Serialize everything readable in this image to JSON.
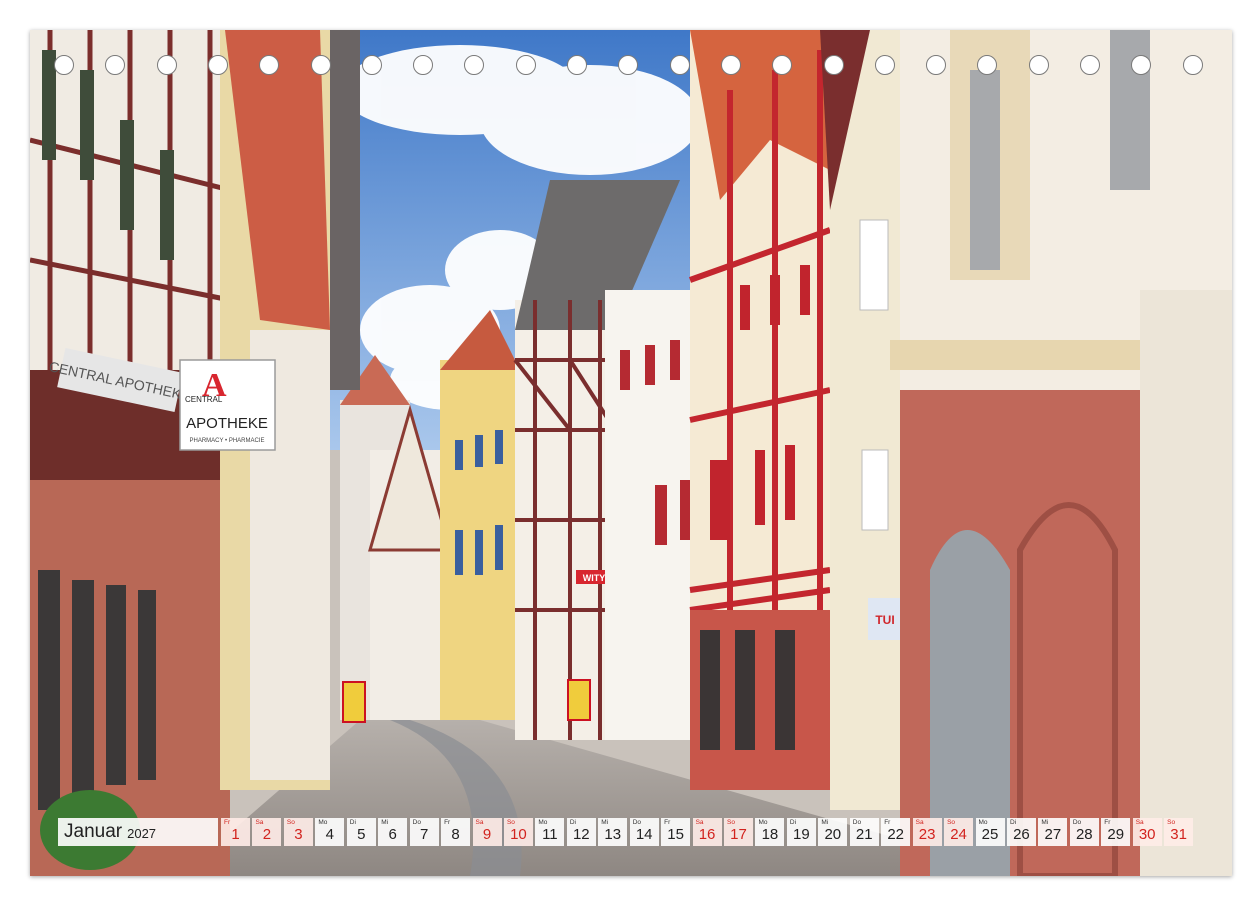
{
  "calendar": {
    "month": "Januar",
    "year": "2027",
    "days": [
      {
        "wd": "Fr",
        "num": "1",
        "weekend": true
      },
      {
        "wd": "Sa",
        "num": "2",
        "weekend": true
      },
      {
        "wd": "So",
        "num": "3",
        "weekend": true
      },
      {
        "wd": "Mo",
        "num": "4",
        "weekend": false
      },
      {
        "wd": "Di",
        "num": "5",
        "weekend": false
      },
      {
        "wd": "Mi",
        "num": "6",
        "weekend": false
      },
      {
        "wd": "Do",
        "num": "7",
        "weekend": false
      },
      {
        "wd": "Fr",
        "num": "8",
        "weekend": false
      },
      {
        "wd": "Sa",
        "num": "9",
        "weekend": true
      },
      {
        "wd": "So",
        "num": "10",
        "weekend": true
      },
      {
        "wd": "Mo",
        "num": "11",
        "weekend": false
      },
      {
        "wd": "Di",
        "num": "12",
        "weekend": false
      },
      {
        "wd": "Mi",
        "num": "13",
        "weekend": false
      },
      {
        "wd": "Do",
        "num": "14",
        "weekend": false
      },
      {
        "wd": "Fr",
        "num": "15",
        "weekend": false
      },
      {
        "wd": "Sa",
        "num": "16",
        "weekend": true
      },
      {
        "wd": "So",
        "num": "17",
        "weekend": true
      },
      {
        "wd": "Mo",
        "num": "18",
        "weekend": false
      },
      {
        "wd": "Di",
        "num": "19",
        "weekend": false
      },
      {
        "wd": "Mi",
        "num": "20",
        "weekend": false
      },
      {
        "wd": "Do",
        "num": "21",
        "weekend": false
      },
      {
        "wd": "Fr",
        "num": "22",
        "weekend": false
      },
      {
        "wd": "Sa",
        "num": "23",
        "weekend": true
      },
      {
        "wd": "So",
        "num": "24",
        "weekend": true
      },
      {
        "wd": "Mo",
        "num": "25",
        "weekend": false
      },
      {
        "wd": "Di",
        "num": "26",
        "weekend": false
      },
      {
        "wd": "Mi",
        "num": "27",
        "weekend": false
      },
      {
        "wd": "Do",
        "num": "28",
        "weekend": false
      },
      {
        "wd": "Fr",
        "num": "29",
        "weekend": false
      },
      {
        "wd": "Sa",
        "num": "30",
        "weekend": true
      },
      {
        "wd": "So",
        "num": "31",
        "weekend": true
      }
    ]
  },
  "signs": {
    "pharmacy_small": "CENTRAL",
    "pharmacy_big": "APOTHEKE",
    "pharmacy_sub": "PHARMACY • PHARMACIE",
    "pharmacy_facade": "CENTRAL APOTHEKE",
    "red_shop": "WITY",
    "travel": "TUI"
  },
  "colors": {
    "weekend": "#d2231e",
    "sky": "#6a9fd8",
    "timber_red": "#b8262e"
  }
}
